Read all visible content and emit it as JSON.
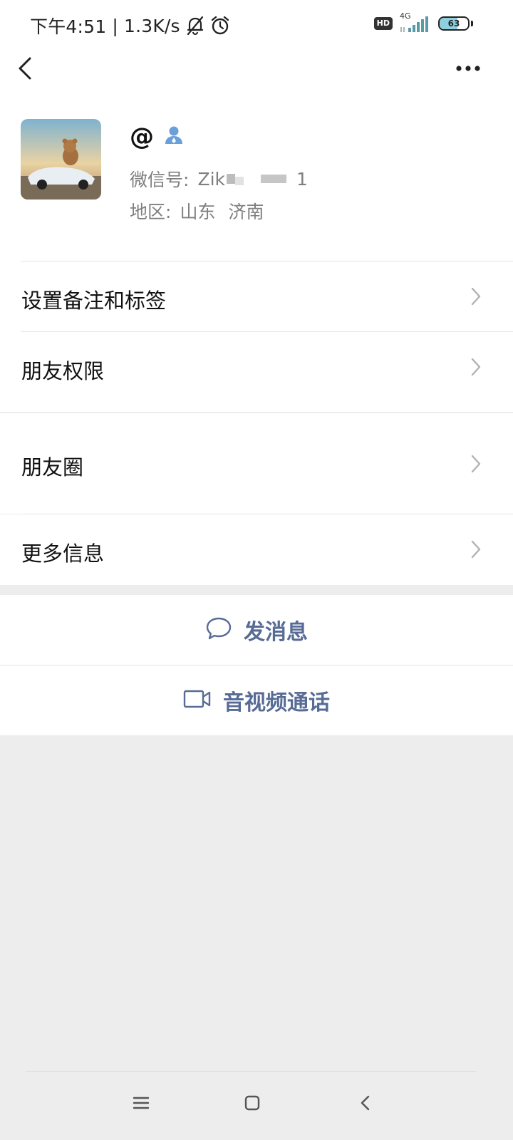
{
  "status_bar": {
    "time": "下午4:51",
    "separator": "|",
    "speed": "1.3K/s",
    "hd_badge": "HD",
    "network": "4G",
    "battery": "63"
  },
  "nav": {
    "back_icon": "chevron-left-icon",
    "more_icon": "more-horizontal-icon"
  },
  "profile": {
    "name": "@",
    "verified_icon": "person-icon",
    "wechat_id_label": "微信号:",
    "wechat_id_value": "Zik",
    "wechat_id_suffix": "1",
    "region_label": "地区:",
    "region_province": "山东",
    "region_city": "济南"
  },
  "menu": [
    {
      "label": "设置备注和标签"
    },
    {
      "label": "朋友权限"
    },
    {
      "label": "朋友圈"
    },
    {
      "label": "更多信息"
    }
  ],
  "actions": {
    "message_label": "发消息",
    "call_label": "音视频通话"
  },
  "colors": {
    "link": "#576b95",
    "background": "#ededed"
  }
}
